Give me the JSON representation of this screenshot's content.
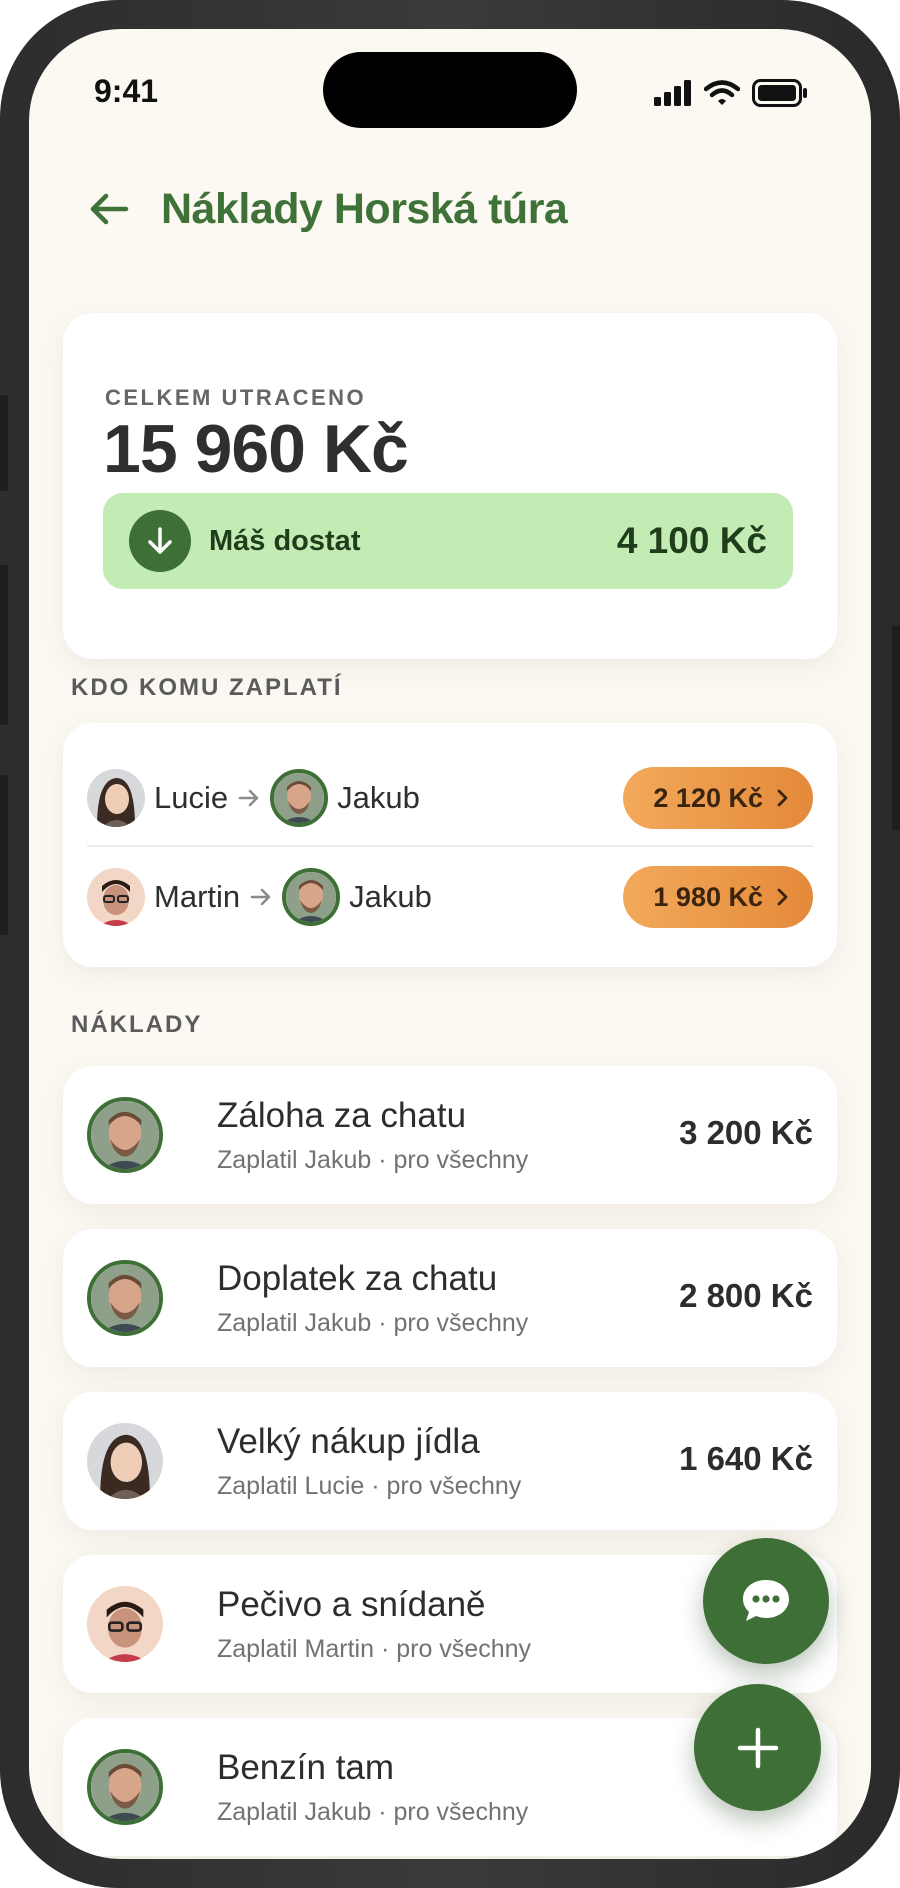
{
  "status_bar": {
    "time": "9:41"
  },
  "header": {
    "title": "Náklady Horská túra"
  },
  "summary": {
    "label": "CELKEM UTRACENO",
    "total": "15 960 Kč",
    "balance_label": "Máš dostat",
    "balance_amount": "4 100 Kč"
  },
  "settlements": {
    "heading": "KDO KOMU ZAPLATÍ",
    "rows": [
      {
        "from": "Lucie",
        "to": "Jakub",
        "amount": "2 120 Kč"
      },
      {
        "from": "Martin",
        "to": "Jakub",
        "amount": "1 980 Kč"
      }
    ]
  },
  "expenses": {
    "heading": "NÁKLADY",
    "items": [
      {
        "title": "Záloha za chatu",
        "subtitle": "Zaplatil Jakub · pro všechny",
        "amount": "3 200 Kč",
        "payer": "Jakub"
      },
      {
        "title": "Doplatek za chatu",
        "subtitle": "Zaplatil Jakub · pro všechny",
        "amount": "2 800 Kč",
        "payer": "Jakub"
      },
      {
        "title": "Velký nákup jídla",
        "subtitle": "Zaplatil Lucie · pro všechny",
        "amount": "1 640 Kč",
        "payer": "Lucie"
      },
      {
        "title": "Pečivo a snídaně",
        "subtitle": "Zaplatil Martin · pro všechny",
        "amount": "",
        "payer": "Martin"
      },
      {
        "title": "Benzín tam",
        "subtitle": "Zaplatil Jakub · pro všechny",
        "amount": "",
        "payer": "Jakub"
      }
    ]
  },
  "colors": {
    "accent": "#3e6f36",
    "title": "#3f7238",
    "balance_bg": "#c3ecb4",
    "pay_button": "#ec9a4a",
    "background": "#fcf9f3"
  },
  "icons": [
    "back-arrow-icon",
    "signal-icon",
    "wifi-icon",
    "battery-icon",
    "arrow-down-icon",
    "arrow-right-icon",
    "chevron-right-icon",
    "chat-icon",
    "plus-icon"
  ]
}
